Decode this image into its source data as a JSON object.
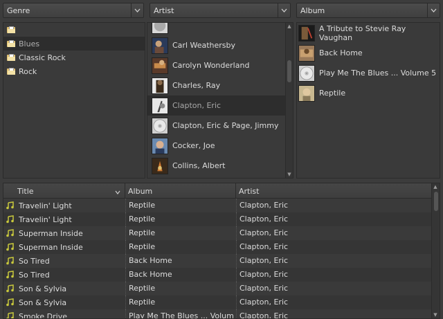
{
  "browser": {
    "genre_combo": "Genre",
    "artist_combo": "Artist",
    "album_combo": "Album",
    "genres": [
      {
        "label": ""
      },
      {
        "label": "Blues",
        "selected": true
      },
      {
        "label": "Classic Rock"
      },
      {
        "label": "Rock"
      }
    ],
    "artists": [
      {
        "label": "Carl Weathersby"
      },
      {
        "label": "Carolyn Wonderland"
      },
      {
        "label": "Charles, Ray"
      },
      {
        "label": "Clapton, Eric",
        "selected": true
      },
      {
        "label": "Clapton, Eric & Page, Jimmy"
      },
      {
        "label": "Cocker, Joe"
      },
      {
        "label": "Collins, Albert"
      }
    ],
    "albums": [
      {
        "label": "A Tribute to Stevie Ray Vaughan"
      },
      {
        "label": "Back Home"
      },
      {
        "label": "Play Me The Blues ... Volume 5"
      },
      {
        "label": "Reptile"
      }
    ]
  },
  "tracklist": {
    "columns": {
      "title": "Title",
      "album": "Album",
      "artist": "Artist"
    },
    "rows": [
      {
        "title": "Travelin' Light",
        "album": "Reptile",
        "artist": "Clapton, Eric"
      },
      {
        "title": "Travelin' Light",
        "album": "Reptile",
        "artist": "Clapton, Eric"
      },
      {
        "title": "Superman Inside",
        "album": "Reptile",
        "artist": "Clapton, Eric"
      },
      {
        "title": "Superman Inside",
        "album": "Reptile",
        "artist": "Clapton, Eric"
      },
      {
        "title": "So Tired",
        "album": "Back Home",
        "artist": "Clapton, Eric"
      },
      {
        "title": "So Tired",
        "album": "Back Home",
        "artist": "Clapton, Eric"
      },
      {
        "title": "Son & Sylvia",
        "album": "Reptile",
        "artist": "Clapton, Eric"
      },
      {
        "title": "Son & Sylvia",
        "album": "Reptile",
        "artist": "Clapton, Eric"
      },
      {
        "title": "Smoke Drive",
        "album": "Play Me The Blues ... Volum",
        "artist": "Clapton, Eric"
      }
    ]
  },
  "colors": {
    "note_icon": "#c8c83c",
    "background": "#3c3c3c",
    "selected_row": "#2d2d2d"
  }
}
